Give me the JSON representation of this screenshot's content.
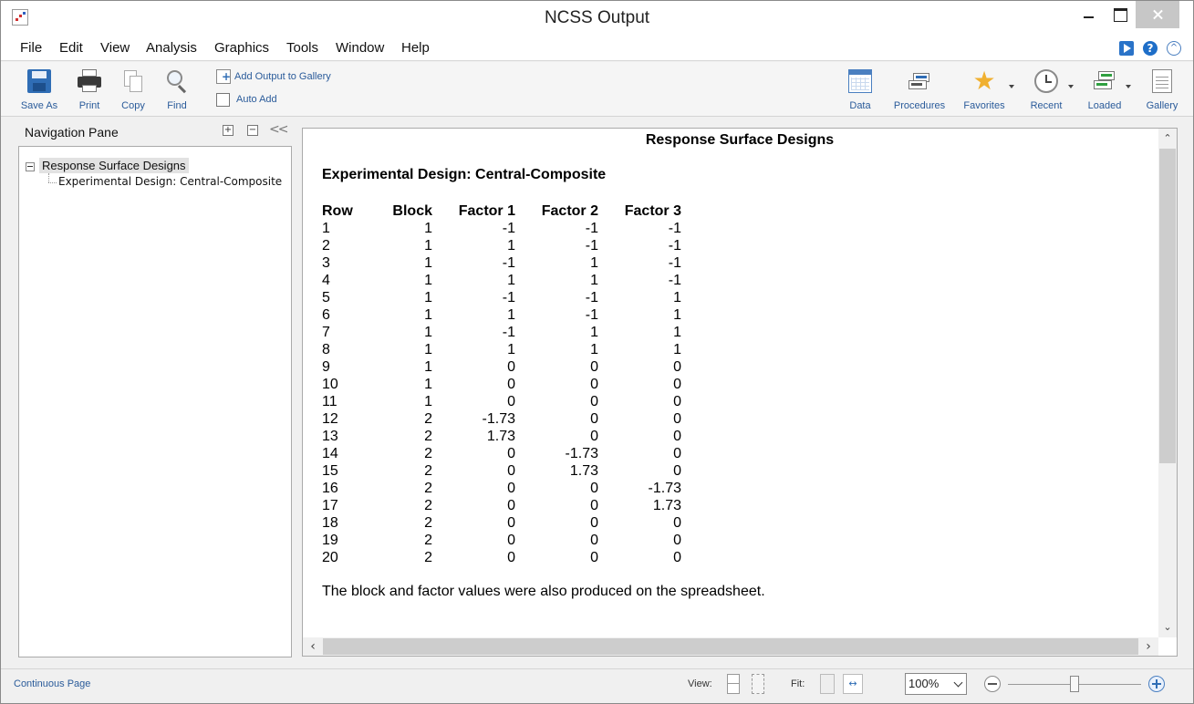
{
  "window": {
    "title": "NCSS Output"
  },
  "menu": [
    "File",
    "Edit",
    "View",
    "Analysis",
    "Graphics",
    "Tools",
    "Window",
    "Help"
  ],
  "toolbar": {
    "save_as": "Save As",
    "print": "Print",
    "copy": "Copy",
    "find": "Find",
    "add_output": "Add Output to Gallery",
    "auto_add": "Auto Add",
    "data": "Data",
    "procedures": "Procedures",
    "favorites": "Favorites",
    "recent": "Recent",
    "loaded": "Loaded",
    "gallery": "Gallery"
  },
  "nav": {
    "title": "Navigation Pane",
    "tree_root": "Response Surface Designs",
    "tree_child": "Experimental Design: Central-Composite"
  },
  "report": {
    "title": "Response Surface Designs",
    "subtitle": "Experimental Design: Central-Composite",
    "headers": [
      "Row",
      "Block",
      "Factor 1",
      "Factor 2",
      "Factor 3"
    ],
    "rows": [
      [
        "1",
        "1",
        "-1",
        "-1",
        "-1"
      ],
      [
        "2",
        "1",
        "1",
        "-1",
        "-1"
      ],
      [
        "3",
        "1",
        "-1",
        "1",
        "-1"
      ],
      [
        "4",
        "1",
        "1",
        "1",
        "-1"
      ],
      [
        "5",
        "1",
        "-1",
        "-1",
        "1"
      ],
      [
        "6",
        "1",
        "1",
        "-1",
        "1"
      ],
      [
        "7",
        "1",
        "-1",
        "1",
        "1"
      ],
      [
        "8",
        "1",
        "1",
        "1",
        "1"
      ],
      [
        "9",
        "1",
        "0",
        "0",
        "0"
      ],
      [
        "10",
        "1",
        "0",
        "0",
        "0"
      ],
      [
        "11",
        "1",
        "0",
        "0",
        "0"
      ],
      [
        "12",
        "2",
        "-1.73",
        "0",
        "0"
      ],
      [
        "13",
        "2",
        "1.73",
        "0",
        "0"
      ],
      [
        "14",
        "2",
        "0",
        "-1.73",
        "0"
      ],
      [
        "15",
        "2",
        "0",
        "1.73",
        "0"
      ],
      [
        "16",
        "2",
        "0",
        "0",
        "-1.73"
      ],
      [
        "17",
        "2",
        "0",
        "0",
        "1.73"
      ],
      [
        "18",
        "2",
        "0",
        "0",
        "0"
      ],
      [
        "19",
        "2",
        "0",
        "0",
        "0"
      ],
      [
        "20",
        "2",
        "0",
        "0",
        "0"
      ]
    ],
    "note": "The block and factor values were also produced on the spreadsheet."
  },
  "status": {
    "mode": "Continuous Page",
    "view_label": "View:",
    "fit_label": "Fit:",
    "zoom": "100%"
  }
}
